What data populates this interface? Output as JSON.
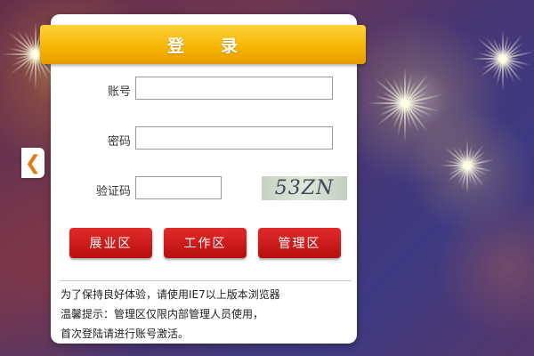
{
  "login": {
    "title": "登　　录",
    "fields": {
      "account_label": "账号",
      "account_value": "",
      "password_label": "密码",
      "password_value": "",
      "captcha_label": "验证码",
      "captcha_value": ""
    },
    "captcha_image_text": "53ZN",
    "buttons": {
      "exhibition": "展业区",
      "work": "工作区",
      "admin": "管理区"
    },
    "notices": [
      "为了保持良好体验，请使用IE7以上版本浏览器",
      "温馨提示：管理区仅限内部管理人员使用，",
      "首次登陆请进行账号激活。"
    ]
  },
  "icons": {
    "back": "chevron-left-icon"
  },
  "colors": {
    "title_bar": "#f5b400",
    "button": "#c41a1a",
    "back_arrow": "#e07a10"
  }
}
